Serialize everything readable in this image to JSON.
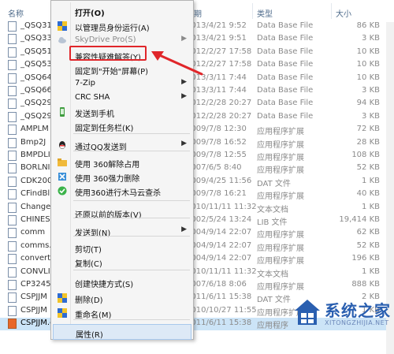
{
  "columns": {
    "name": "名称",
    "date": "日期",
    "type": "类型",
    "size": "大小"
  },
  "files": [
    {
      "name": "_QSQ31",
      "date": "2013/4/21 9:52",
      "type": "Data Base File",
      "size": "86 KB"
    },
    {
      "name": "_QSQ33",
      "date": "2013/4/21 9:51",
      "type": "Data Base File",
      "size": "3 KB"
    },
    {
      "name": "_QSQ51",
      "date": "2012/2/27 17:58",
      "type": "Data Base File",
      "size": "10 KB"
    },
    {
      "name": "_QSQ53",
      "date": "2012/2/27 17:58",
      "type": "Data Base File",
      "size": "10 KB"
    },
    {
      "name": "_QSQ64",
      "date": "2013/3/11 7:44",
      "type": "Data Base File",
      "size": "10 KB"
    },
    {
      "name": "_QSQ66",
      "date": "2013/3/11 7:44",
      "type": "Data Base File",
      "size": "3 KB"
    },
    {
      "name": "_QSQ29",
      "date": "2012/2/28 20:27",
      "type": "Data Base File",
      "size": "94 KB"
    },
    {
      "name": "_QSQ29",
      "date": "2012/2/28 20:27",
      "type": "Data Base File",
      "size": "3 KB"
    },
    {
      "name": "AMPLM",
      "date": "2009/7/8 12:30",
      "type": "应用程序扩展",
      "size": "72 KB"
    },
    {
      "name": "Bmp2J",
      "date": "2009/7/8 16:52",
      "type": "应用程序扩展",
      "size": "28 KB"
    },
    {
      "name": "BMPDLI",
      "date": "2009/7/8 12:55",
      "type": "应用程序扩展",
      "size": "108 KB"
    },
    {
      "name": "BORLNI",
      "date": "2007/6/5 8:40",
      "type": "应用程序扩展",
      "size": "52 KB"
    },
    {
      "name": "CDK200",
      "date": "2009/4/25 11:56",
      "type": "DAT 文件",
      "size": "1 KB"
    },
    {
      "name": "CFindBl",
      "date": "2009/7/8 16:21",
      "type": "应用程序扩展",
      "size": "40 KB"
    },
    {
      "name": "Change",
      "date": "2010/11/11 11:32",
      "type": "文本文档",
      "size": "1 KB"
    },
    {
      "name": "CHINES",
      "date": "2002/5/24 13:24",
      "type": "LIB 文件",
      "size": "19,414 KB"
    },
    {
      "name": "comm",
      "date": "2004/9/14 22:07",
      "type": "应用程序扩展",
      "size": "62 KB"
    },
    {
      "name": "comms.",
      "date": "2004/9/14 22:07",
      "type": "应用程序扩展",
      "size": "52 KB"
    },
    {
      "name": "convert",
      "date": "2004/9/14 22:07",
      "type": "应用程序扩展",
      "size": "196 KB"
    },
    {
      "name": "CONVLI",
      "date": "2010/11/11 11:32",
      "type": "文本文档",
      "size": "1 KB"
    },
    {
      "name": "CP3245",
      "date": "2007/6/18 8:06",
      "type": "应用程序扩展",
      "size": "888 KB"
    },
    {
      "name": "CSPJJM",
      "date": "2011/6/11 15:38",
      "type": "DAT 文件",
      "size": "2 KB"
    },
    {
      "name": "CSPJJM",
      "date": "2010/10/27 11:55",
      "type": "应用程序扩展",
      "size": "1 KB"
    },
    {
      "name": "CSPJJM.exe",
      "date": "2011/6/11 15:38",
      "type": "应用程序",
      "size": ""
    }
  ],
  "context_menu": {
    "items": [
      {
        "label": "打开(O)",
        "icon": "",
        "bold": true
      },
      {
        "label": "以管理员身份运行(A)",
        "icon": "shield-icon"
      },
      {
        "label": "SkyDrive Pro(S)",
        "icon": "cloud-icon",
        "disabled": true,
        "submenu": true
      },
      {
        "label": "兼容性疑难解答(Y)",
        "icon": ""
      },
      {
        "label": "固定到\"开始\"屏幕(P)",
        "icon": ""
      },
      {
        "label": "7-Zip",
        "icon": "",
        "submenu": true
      },
      {
        "label": "CRC SHA",
        "icon": "",
        "submenu": true
      },
      {
        "label": "发送到手机",
        "icon": "phone-icon"
      },
      {
        "label": "固定到任务栏(K)",
        "icon": ""
      },
      {
        "label": "通过QQ发送到",
        "icon": "qq-icon",
        "submenu": true
      },
      {
        "label": "使用 360解除占用",
        "icon": "folder-icon"
      },
      {
        "label": "使用 360强力删除",
        "icon": "delete-icon"
      },
      {
        "label": "使用360进行木马云查杀",
        "icon": "shield-360-icon"
      },
      {
        "label": "还原以前的版本(V)",
        "icon": ""
      },
      {
        "label": "发送到(N)",
        "icon": "",
        "submenu": true
      },
      {
        "label": "剪切(T)",
        "icon": ""
      },
      {
        "label": "复制(C)",
        "icon": ""
      },
      {
        "label": "创建快捷方式(S)",
        "icon": ""
      },
      {
        "label": "删除(D)",
        "icon": "shield-icon"
      },
      {
        "label": "重命名(M)",
        "icon": "shield-icon"
      },
      {
        "label": "属性(R)",
        "icon": ""
      }
    ]
  },
  "watermark": {
    "title": "系统之家",
    "subtitle": "XITONGZHIJIA.NET"
  },
  "colors": {
    "highlight_box": "#e0262a",
    "menu_hover": "#dde9f6",
    "selection": "#cce4f7",
    "watermark_blue": "#2a5fb0"
  }
}
